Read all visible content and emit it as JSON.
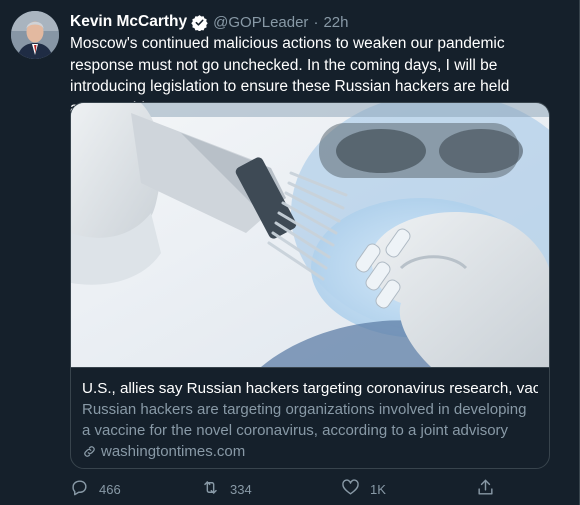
{
  "tweet": {
    "author_name": "Kevin McCarthy",
    "handle": "@GOPLeader",
    "separator": "·",
    "time": "22h",
    "verified_icon": "verified-badge-icon",
    "text": "Moscow's continued malicious actions to weaken our pandemic response must not go unchecked. In the coming days, I will be introducing legislation to ensure these Russian hackers are held accountable."
  },
  "card": {
    "image_description": "lab-technician-pipette-photo",
    "title": "U.S., allies say Russian hackers targeting coronavirus research, vacci",
    "description": "Russian hackers are targeting organizations involved in developing a vaccine for the novel coronavirus, according to a joint advisory issue...",
    "link_icon": "link-icon",
    "domain": "washingtontimes.com"
  },
  "actions": {
    "reply_count": "466",
    "retweet_count": "334",
    "like_count": "1K",
    "reply_icon": "reply-icon",
    "retweet_icon": "retweet-icon",
    "like_icon": "heart-icon",
    "share_icon": "share-icon"
  },
  "colors": {
    "background": "#15202b",
    "text_primary": "#ffffff",
    "text_secondary": "#8899a6",
    "border": "#38444d",
    "verified": "#1da1f2"
  }
}
